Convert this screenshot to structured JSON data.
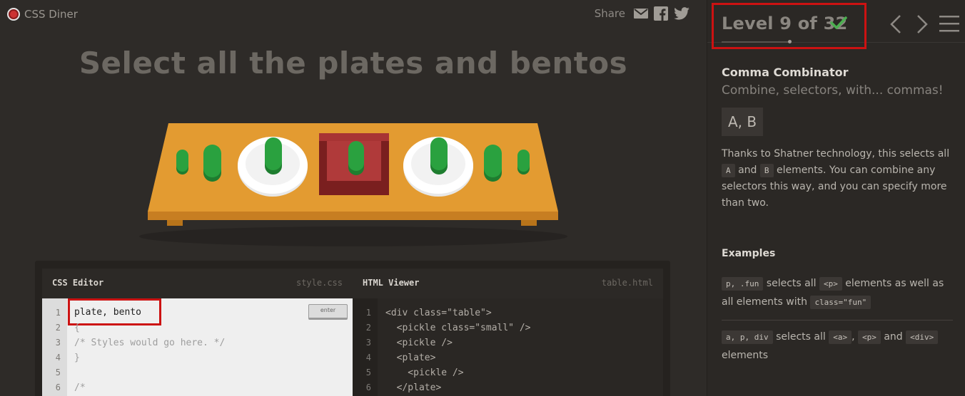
{
  "app": {
    "logo_text": "CSS Diner"
  },
  "share": {
    "label": "Share",
    "icons": [
      "mail-icon",
      "facebook-icon",
      "twitter-icon"
    ]
  },
  "instruction": "Select all the plates and bentos",
  "table_items": [
    "pickle small",
    "pickle",
    "plate with pickle",
    "bento with pickle",
    "plate with pickle",
    "pickle",
    "pickle small"
  ],
  "editor": {
    "css": {
      "title": "CSS Editor",
      "file": "style.css",
      "input_value": "plate, bento",
      "enter_label": "enter",
      "line_numbers": [
        "1",
        "2",
        "3",
        "4",
        "5",
        "6"
      ],
      "lines": [
        "{",
        "/* Styles would go here. */",
        "}",
        "",
        "/*"
      ]
    },
    "html": {
      "title": "HTML Viewer",
      "file": "table.html",
      "line_numbers": [
        "1",
        "2",
        "3",
        "4",
        "5",
        "6"
      ],
      "lines": [
        "<div class=\"table\">",
        "  <pickle class=\"small\" />",
        "  <pickle />",
        "  <plate>",
        "    <pickle />",
        "  </plate>"
      ]
    }
  },
  "sidebar": {
    "level_text": "Level 9 of 32",
    "completed": true,
    "progress": 0.28,
    "heading": "Comma Combinator",
    "subheading": "Combine, selectors, with... commas!",
    "syntax": "A, B",
    "desc_1": "Thanks to Shatner technology, this selects all",
    "code_a": "A",
    "desc_and": "and",
    "code_b": "B",
    "desc_2": "elements. You can combine any selectors this way, and you can specify more than two.",
    "examples_heading": "Examples",
    "ex1_code": "p, .fun",
    "ex1_text_1": "selects all",
    "ex1_code_2": "<p>",
    "ex1_text_2": "elements as well as all elements with",
    "ex1_code_3": "class=\"fun\"",
    "ex2_code": "a, p, div",
    "ex2_text_1": "selects all",
    "ex2_code_2": "<a>",
    "ex2_comma": ",",
    "ex2_code_3": "<p>",
    "ex2_and": "and",
    "ex2_code_4": "<div>",
    "ex2_text_2": "elements"
  },
  "colors": {
    "accent_red": "#cc1212",
    "check_green": "#4caf50",
    "table": "#e6a030",
    "pickle": "#23a03a",
    "bento": "#a52a2a"
  }
}
